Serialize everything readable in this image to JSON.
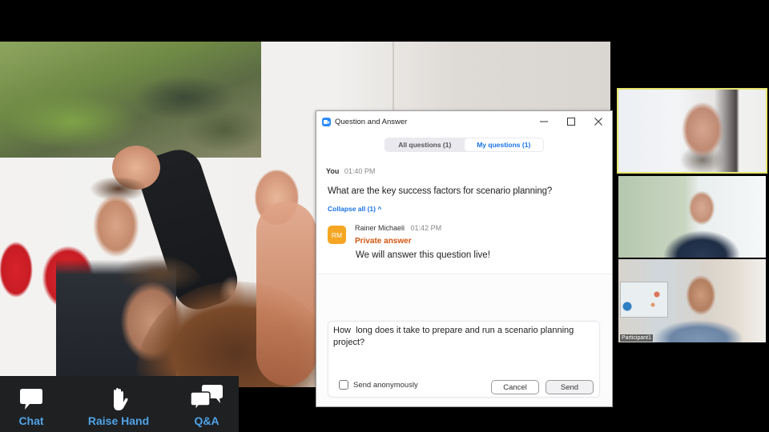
{
  "meeting": {
    "photo_description": "audience with raised hands",
    "toolbar": {
      "buttons": [
        {
          "id": "chat",
          "label": "Chat",
          "icon": "chat-bubble-icon"
        },
        {
          "id": "raise_hand",
          "label": "Raise Hand",
          "icon": "raised-hand-icon"
        },
        {
          "id": "qa",
          "label": "Q&A",
          "icon": "qa-bubbles-icon"
        }
      ]
    },
    "video_tiles": [
      {
        "name": "",
        "active_speaker": true
      },
      {
        "name": "",
        "active_speaker": false
      },
      {
        "name": "Participant1",
        "active_speaker": false
      }
    ]
  },
  "dialog": {
    "title": "Question and Answer",
    "window_controls": {
      "minimize": "—",
      "maximize": "☐",
      "close": "✕"
    },
    "tabs": [
      {
        "label": "All questions (1)",
        "active": false
      },
      {
        "label": "My questions (1)",
        "active": true
      }
    ],
    "question": {
      "author": "You",
      "time": "01:40 PM",
      "text": "What are the key success factors for scenario planning?",
      "collapse_label": "Collapse all (1) ^"
    },
    "answer": {
      "avatar_initials": "RM",
      "avatar_color": "#f5a623",
      "author": "Rainer Michaeli",
      "time": "01:42 PM",
      "tag": "Private answer",
      "text": "We will answer this question live!"
    },
    "compose": {
      "value": "How  long does it take to prepare and run a scenario planning project?",
      "anonymous_label": "Send anonymously",
      "anonymous_checked": false,
      "cancel_label": "Cancel",
      "send_label": "Send"
    }
  },
  "colors": {
    "accent_blue": "#1a73e8",
    "private_orange": "#d2550f",
    "toolbar_label_blue": "#4fa3e8",
    "active_speaker_border": "#e6e66e"
  }
}
